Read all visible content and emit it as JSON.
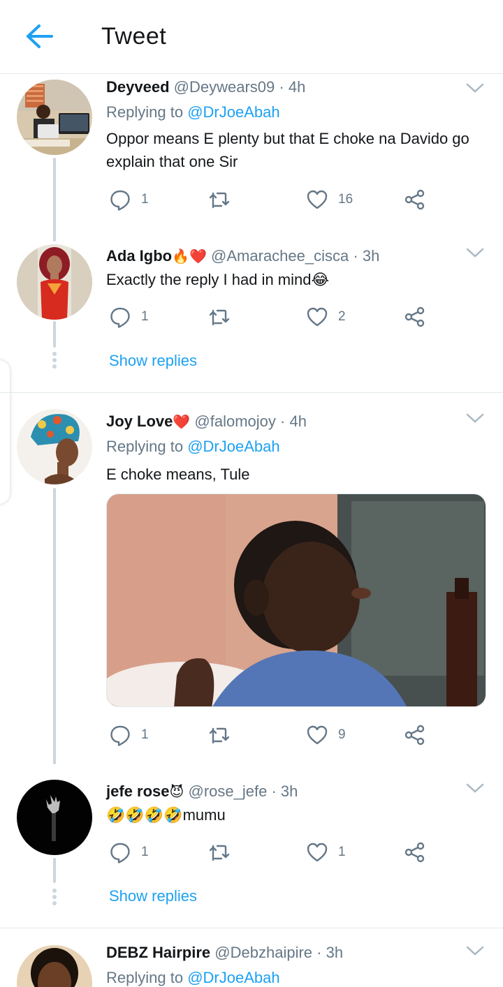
{
  "header": {
    "title": "Tweet"
  },
  "tweets": [
    {
      "name": "Deyveed",
      "name_emoji": "",
      "handle": "@Deywears09",
      "time": "4h",
      "replying_prefix": "Replying to",
      "replying_to": "@DrJoeAbah",
      "text": "Oppor means E plenty but that E choke na Davido go explain that one Sir",
      "replies": "1",
      "retweets": "",
      "likes": "16"
    },
    {
      "name": "Ada Igbo",
      "name_emoji": "🔥❤️",
      "handle": "@Amarachee_cisca",
      "time": "3h",
      "text": "Exactly the reply I had in mind😂",
      "replies": "1",
      "retweets": "",
      "likes": "2",
      "show_replies": "Show replies"
    },
    {
      "name": "Joy Love",
      "name_emoji": "❤️",
      "handle": "@falomojoy",
      "time": "4h",
      "replying_prefix": "Replying to",
      "replying_to": "@DrJoeAbah",
      "text": "E choke means, Tule",
      "replies": "1",
      "retweets": "",
      "likes": "9"
    },
    {
      "name": "jefe rose",
      "name_emoji": "😈",
      "handle": "@rose_jefe",
      "time": "3h",
      "text": "🤣🤣🤣🤣mumu",
      "replies": "1",
      "retweets": "",
      "likes": "1",
      "show_replies": "Show replies"
    },
    {
      "name": "DEBZ Hairpire",
      "name_emoji": "",
      "handle": "@Debzhaipire",
      "time": "3h",
      "replying_prefix": "Replying to",
      "replying_to": "@DrJoeAbah"
    }
  ],
  "separator": "·",
  "colors": {
    "accent": "#1da1f2",
    "secondary_text": "#657786",
    "divider": "#e1e8ed",
    "thread_line": "#ccd6dd"
  },
  "icons": [
    "back-arrow-icon",
    "chevron-down-icon",
    "reply-icon",
    "retweet-icon",
    "like-icon",
    "share-icon"
  ]
}
